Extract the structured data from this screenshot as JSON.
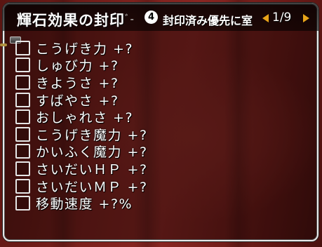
{
  "title_bar": {
    "title": "輝石効果の封印",
    "cut_off_text": "ﾞ-",
    "button_glyph": "4",
    "seal_priority_text": "封印済み優先に室",
    "page_indicator": "1/9"
  },
  "effects": [
    {
      "label": "こうげき力 +?",
      "checked": false
    },
    {
      "label": "しゅび力 +?",
      "checked": false
    },
    {
      "label": "きようさ +?",
      "checked": false
    },
    {
      "label": "すばやさ +?",
      "checked": false
    },
    {
      "label": "おしゃれさ +?",
      "checked": false
    },
    {
      "label": "こうげき魔力 +?",
      "checked": false
    },
    {
      "label": "かいふく魔力 +?",
      "checked": false
    },
    {
      "label": "さいだいＨＰ +?",
      "checked": false
    },
    {
      "label": "さいだいＭＰ +?",
      "checked": false
    },
    {
      "label": "移動速度 +?%",
      "checked": false
    }
  ],
  "colors": {
    "page_arrow": "#e8a419",
    "window_border": "#e9e9e9",
    "background_curtain": "#7d211d"
  }
}
